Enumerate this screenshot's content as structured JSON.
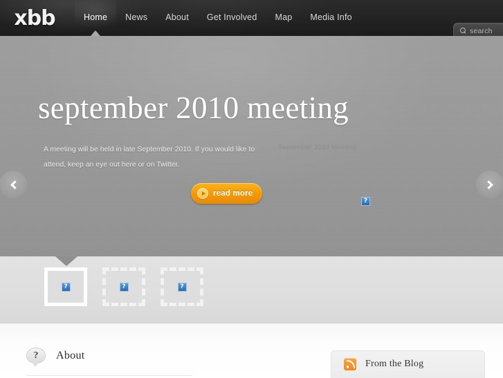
{
  "site": {
    "logo_text": "xbb",
    "logo_icon": "logo-wordmark"
  },
  "nav": {
    "items": [
      {
        "label": "Home",
        "active": true
      },
      {
        "label": "News",
        "active": false
      },
      {
        "label": "About",
        "active": false
      },
      {
        "label": "Get Involved",
        "active": false
      },
      {
        "label": "Map",
        "active": false
      },
      {
        "label": "Media Info",
        "active": false
      }
    ]
  },
  "search": {
    "placeholder": "search",
    "icon": "magnifier-icon"
  },
  "hero": {
    "title": "september 2010 meeting",
    "description": "A meeting will be held in late September 2010. If you would like to attend, keep an eye out here or on Twitter.",
    "button_label": "read more",
    "button_icon": "play-circle-icon",
    "image_alt": "September 2010 Meeting",
    "broken_image_glyph": "?",
    "prev_icon": "chevron-left-icon",
    "next_icon": "chevron-right-icon"
  },
  "thumbnails": {
    "items": [
      {
        "state": "active",
        "glyph": "?"
      },
      {
        "state": "idle",
        "glyph": "?"
      },
      {
        "state": "idle",
        "glyph": "?"
      }
    ]
  },
  "content": {
    "about": {
      "title": "About",
      "icon": "question-bubble-icon"
    },
    "blog": {
      "title": "From the Blog",
      "icon": "rss-icon"
    }
  },
  "colors": {
    "nav_bg": "#242424",
    "hero_bg": "#9a9a9a",
    "accent_orange": "#f39b09",
    "rss_orange": "#f08818",
    "broken_blue": "#2a6ab0",
    "strip_bg": "#dedede"
  }
}
